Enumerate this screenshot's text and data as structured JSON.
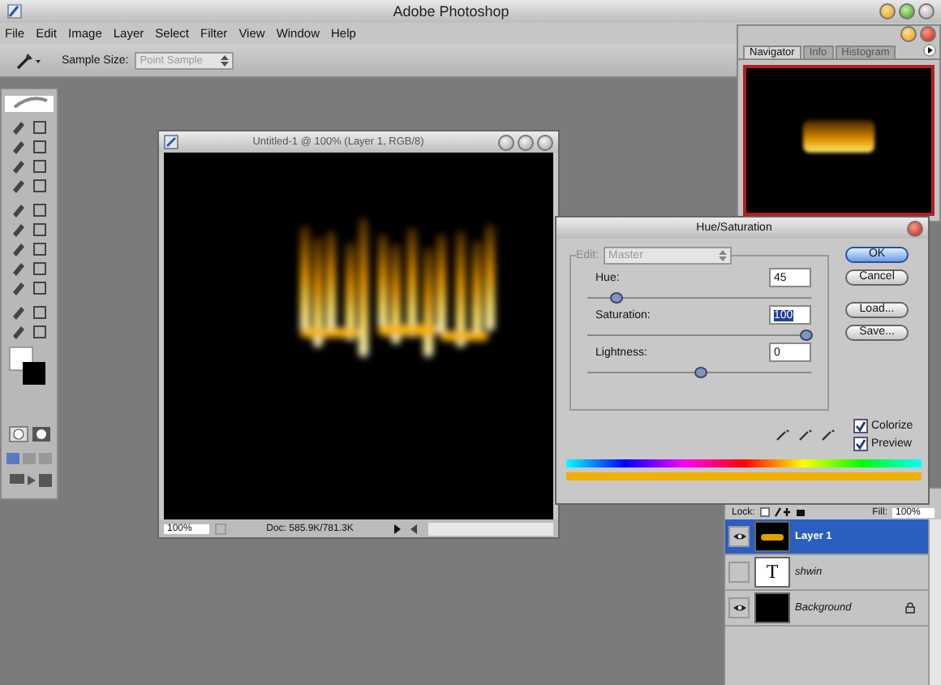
{
  "window": {
    "title": "Adobe Photoshop"
  },
  "menu": [
    "File",
    "Edit",
    "Image",
    "Layer",
    "Select",
    "Filter",
    "View",
    "Window",
    "Help"
  ],
  "options_bar": {
    "label": "Sample Size:",
    "value": "Point Sample"
  },
  "navigator": {
    "tabs": [
      {
        "label": "Navigator",
        "selected": true
      },
      {
        "label": "Info",
        "selected": false
      },
      {
        "label": "Histogram",
        "selected": false
      }
    ]
  },
  "document": {
    "title": "Untitled-1 @ 100% (Layer 1, RGB/8)",
    "zoom": "100%",
    "status": "Doc: 585.9K/781.3K"
  },
  "dialog": {
    "title": "Hue/Saturation",
    "edit_label": "Edit:",
    "edit_value": "Master",
    "edit_disabled": true,
    "sliders": [
      {
        "label": "Hue:",
        "value": "45",
        "level": 0.12,
        "selected": false
      },
      {
        "label": "Saturation:",
        "value": "100",
        "level": 0.97,
        "selected": true
      },
      {
        "label": "Lightness:",
        "value": "0",
        "level": 0.5,
        "selected": false
      }
    ],
    "buttons": [
      {
        "label": "OK",
        "default": true
      },
      {
        "label": "Cancel",
        "default": false
      },
      {
        "label": "Load...",
        "default": false
      },
      {
        "label": "Save...",
        "default": false
      }
    ],
    "checkboxes": [
      {
        "label": "Colorize",
        "checked": true
      },
      {
        "label": "Preview",
        "checked": true
      }
    ]
  },
  "layers": {
    "lock_label": "Lock:",
    "fill_label": "Fill:",
    "fill_value": "100%",
    "rows": [
      {
        "name": "Layer 1",
        "kind": "image",
        "visible": true,
        "selected": true,
        "locked": false
      },
      {
        "name": "shwin",
        "kind": "text",
        "thumb_text": "T",
        "visible": false,
        "selected": false,
        "locked": false
      },
      {
        "name": "Background",
        "kind": "fill",
        "visible": true,
        "selected": false,
        "locked": true
      }
    ]
  }
}
